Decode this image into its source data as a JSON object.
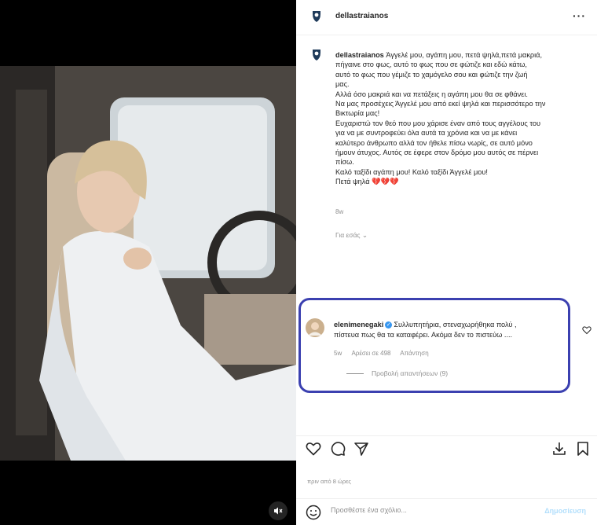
{
  "post": {
    "username": "dellastraianos",
    "more_label": "···",
    "caption_lines": [
      "Άγγελέ μου, αγάπη μου, πετά ψηλά,πετά μακριά,",
      "πήγαινε στο φως, αυτό το φως που σε φώτιζε και εδώ κάτω,",
      "αυτό το φως που γέμιζε το χαμόγελο σου και φώτιζε την ζωή",
      "μας.",
      "Αλλά όσο μακριά και να πετάξεις η αγάπη μου θα σε φθάνει.",
      "Να μας προσέχεις Άγγελέ μου από εκεί ψηλά και περισσότερο την",
      "Βικτωρία μας!",
      "Ευχαριστώ τον θεό που μου χάρισε έναν από τους αγγέλους του",
      "για να με συντροφεύει όλα αυτά τα χρόνια και να με κάνει",
      "καλύτερο άνθρωπο αλλά τον ήθελε πίσω νωρίς, σε αυτό μόνο",
      "ήμουν άτυχος. Αυτός σε έφερε στον δρόμο μου αυτός σε πέρνει",
      "πίσω.",
      "Καλό ταξίδι αγάπη μου! Καλό ταξίδι Άγγελέ μου!",
      "Πετά ψηλά 💔💔💔"
    ],
    "caption_time": "8w",
    "translate_label": "Για εσάς",
    "post_time": "πριν από 8 ώρες"
  },
  "comment": {
    "username": "elenimenegaki",
    "text_line1": "Συλλυπητήρια, στεναχωρήθηκα πολύ ,",
    "text_line2": "πίστευα πως θα τα καταφέρει. Ακόμα δεν το πιστεύω ....",
    "time": "5w",
    "likes": "Αρέσει σε 498",
    "reply_label": "Απάντηση",
    "view_replies": "Προβολή απαντήσεων (9)"
  },
  "composer": {
    "placeholder": "Προσθέστε ένα σχόλιο...",
    "publish_label": "Δημοσίευση"
  },
  "colors": {
    "highlight_border": "#3b40b0",
    "verified": "#3897f0",
    "publish": "#b2dffc",
    "muted_text": "#8e8e8e"
  },
  "icons": [
    "heart-icon",
    "comment-icon",
    "share-icon",
    "download-icon",
    "bookmark-icon",
    "emoji-icon",
    "speaker-muted-icon",
    "more-icon"
  ]
}
